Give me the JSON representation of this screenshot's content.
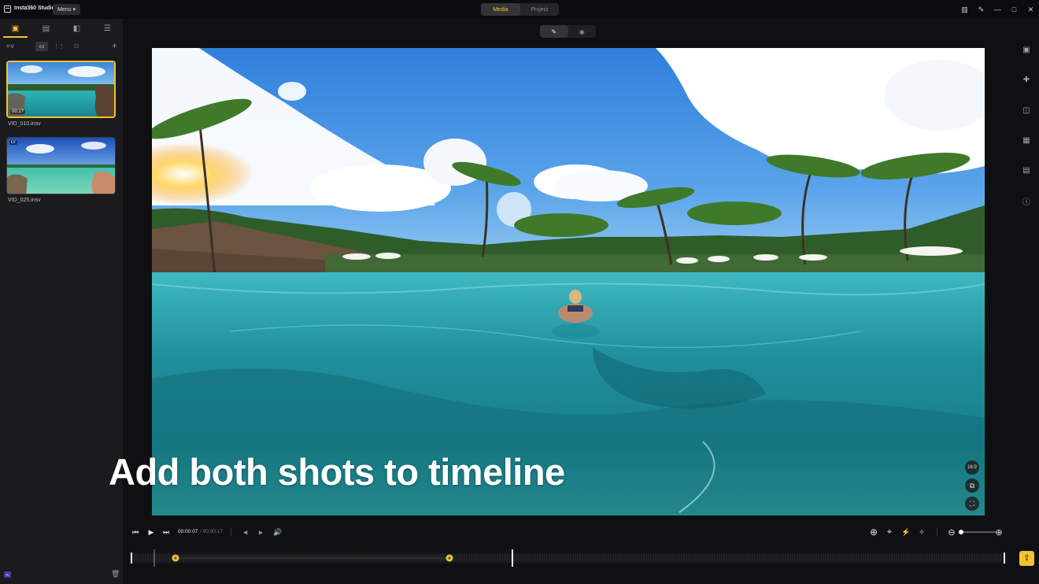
{
  "app": {
    "name": "Insta360 Studio",
    "menu_label": "Menu",
    "menu_caret": "▾"
  },
  "mode_tabs": [
    {
      "label": "Media",
      "active": true
    },
    {
      "label": "Project",
      "active": false
    }
  ],
  "window_controls": {
    "layout_icon": "▥",
    "note_icon": "✎",
    "minimize": "—",
    "maximize": "□",
    "close": "✕"
  },
  "left_panel": {
    "tabs": [
      {
        "icon": "media-library-icon",
        "glyph": "▣",
        "active": true
      },
      {
        "icon": "folder-icon",
        "glyph": "▤",
        "active": false
      },
      {
        "icon": "import-icon",
        "glyph": "◧",
        "active": false
      },
      {
        "icon": "notes-icon",
        "glyph": "☰",
        "active": false
      }
    ],
    "sort_glyph": "≡∨",
    "add_glyph": "+",
    "view_modes": [
      {
        "glyph": "▭",
        "active": true
      },
      {
        "glyph": "⋮⋮",
        "active": false
      },
      {
        "glyph": "☷",
        "active": false
      }
    ],
    "clips": [
      {
        "filename": "VID_010.insv",
        "duration": "00:1?",
        "selected": true
      },
      {
        "filename": "VID_025.insv",
        "badge": "LV",
        "selected": false
      }
    ],
    "bottom_badge": "Pr",
    "trash_glyph": "🗑"
  },
  "preview": {
    "modes": [
      {
        "glyph": "✎",
        "active": true
      },
      {
        "glyph": "◉",
        "active": false
      }
    ],
    "caption": "Add both shots to timeline",
    "aspect_label": "16:9",
    "overlay_icons": [
      "⧉",
      "⛶"
    ]
  },
  "right_tools": [
    "▣",
    "✚",
    "◫",
    "▦",
    "▤",
    "ⓘ"
  ],
  "controls": {
    "prev_glyph": "⏮",
    "play_glyph": "▶",
    "next_glyph": "⏭",
    "current_time": "00:00:07",
    "total_time": "/ 00:00:17",
    "split_left": "⫷",
    "split_right": "⫸",
    "volume_glyph": "🔊",
    "add_keyframe": "⊕",
    "focus_glyph": "⌖",
    "speed_glyph": "⚡",
    "track_glyph": "✧",
    "zoom_out": "⊖",
    "zoom_in": "⊕"
  },
  "export_glyph": "⇪"
}
